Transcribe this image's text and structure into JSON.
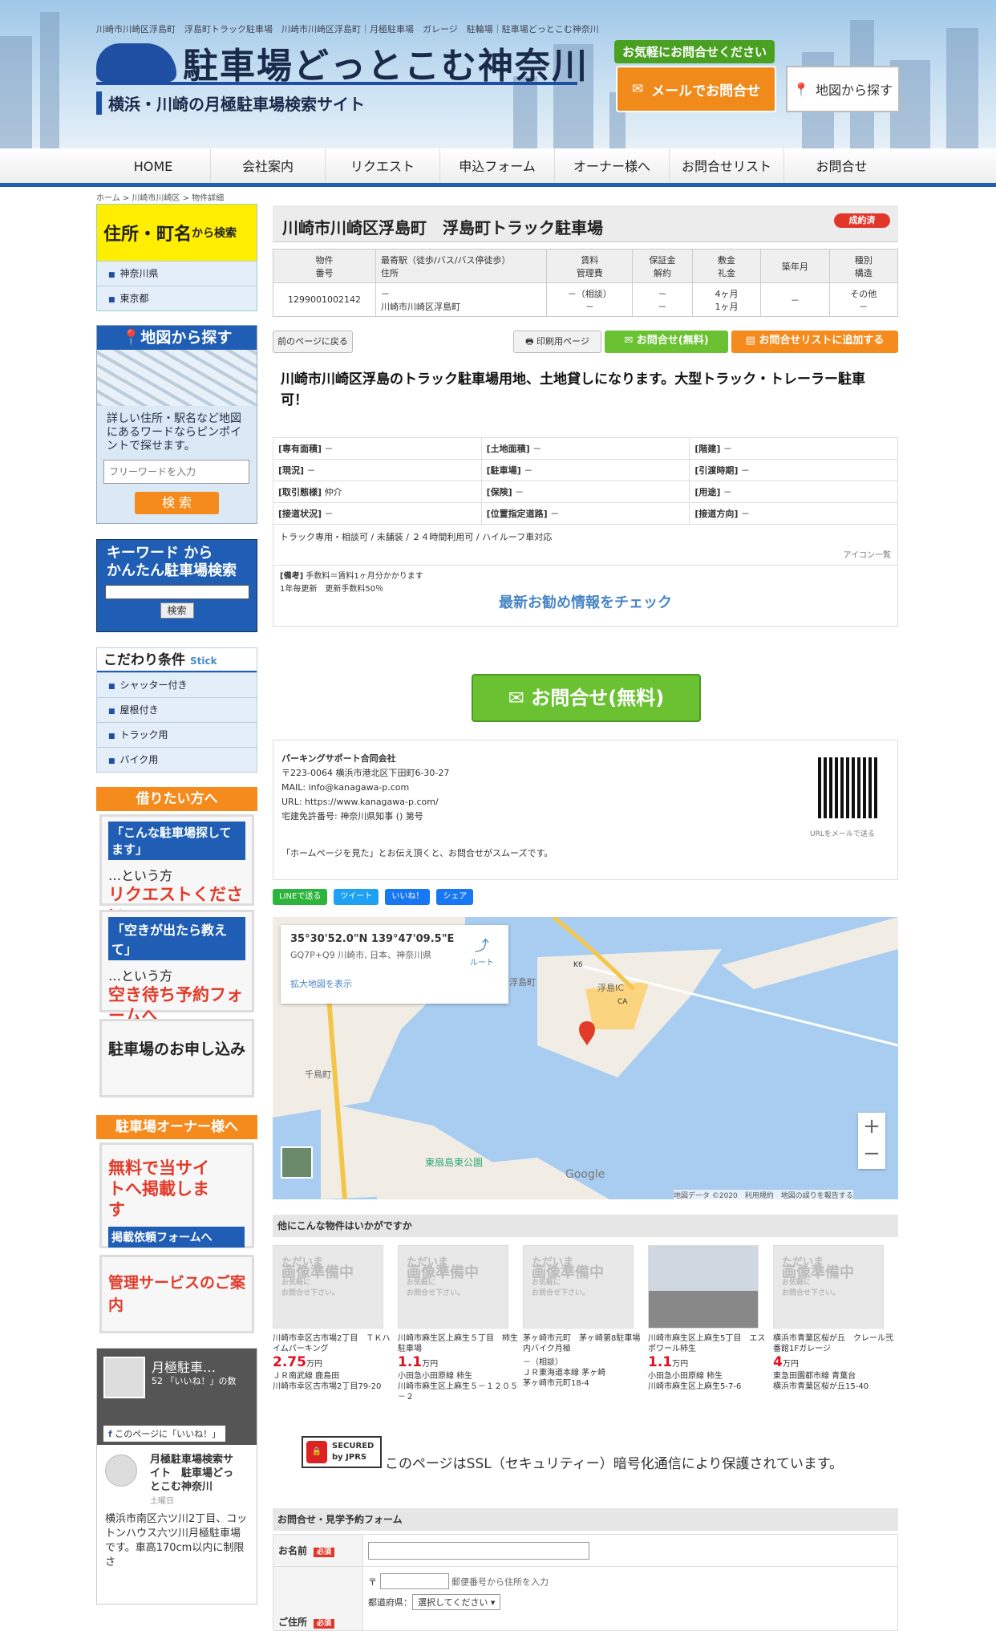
{
  "header": {
    "top_links": "川崎市川崎区浮島町　浮島町トラック駐車場　川崎市川崎区浮島町｜月極駐車場　ガレージ　駐輪場｜駐車場どっとこむ神奈川",
    "logo_title": "駐車場どっとこむ神奈川",
    "logo_sub": "横浜・川崎の月極駐車場検索サイト",
    "contact_label": "お気軽にお問合せください",
    "mail_button": "メールでお問合せ",
    "map_button": "地図から探す"
  },
  "nav": [
    "HOME",
    "会社案内",
    "リクエスト",
    "申込フォーム",
    "オーナー様へ",
    "お問合せリスト",
    "お問合せ"
  ],
  "breadcrumb": "ホーム > 川崎市川崎区 > 物件詳細",
  "sidebar": {
    "addr_title": "住所・町名",
    "addr_title_small": "から検索",
    "addr_items": [
      "神奈川県",
      "東京都"
    ],
    "map_title": "地図から探す",
    "map_text": "詳しい住所・駅名など地図にあるワードならピンポイントで探せます。",
    "map_placeholder": "フリーワードを入力",
    "map_button": "検 索",
    "kw_title": "キーワード から\nかんたん駐車場検索",
    "kw_button": "検索",
    "cond_title": "こだわり条件",
    "cond_stick": "Stick",
    "cond_items": [
      "シャッター付き",
      "屋根付き",
      "トラック用",
      "バイク用"
    ],
    "renter_head": "借りたい方へ",
    "banner1_top": "「こんな駐車場探してます」",
    "banner1_mid": "…という方",
    "banner1_big": "リクエストください",
    "banner2_top": "「空きが出たら教えて」",
    "banner2_mid": "…という方",
    "banner2_big": "空き待ち予約フォームへ",
    "banner3": "駐車場のお申し込み",
    "owner_head": "駐車場オーナー様へ",
    "banner4_big": "無料で当サイトへ掲載します",
    "banner4_sub": "掲載依頼フォームへ",
    "banner5": "管理サービスのご案内",
    "fb_title": "月極駐車…",
    "fb_likes": "52 「いいね！」の数",
    "fb_like_page": "このページに「いいね！」",
    "fb_page_name": "月極駐車場検索サイト　駐車場どっとこむ神奈川",
    "fb_day": "土曜日",
    "fb_post": "横浜市南区六ツ川2丁目、コットンハウス六ツ川月極駐車場です。車高170cm以内に制限さ"
  },
  "main": {
    "title": "川崎市川崎区浮島町　浮島町トラック駐車場",
    "badge": "成約済",
    "spec_headers": [
      [
        "物件",
        "番号"
      ],
      [
        "最寄駅（徒歩/バス/バス停徒歩）",
        "住所"
      ],
      [
        "賃料",
        "管理費"
      ],
      [
        "保証金",
        "解約"
      ],
      [
        "敷金",
        "礼金"
      ],
      [
        "築年月",
        ""
      ],
      [
        "種別",
        "構造"
      ]
    ],
    "spec_values": [
      [
        "1299001002142",
        ""
      ],
      [
        "－",
        "川崎市川崎区浮島町"
      ],
      [
        "－（相談）",
        "－"
      ],
      [
        "－",
        "－"
      ],
      [
        "4ヶ月",
        "1ヶ月"
      ],
      [
        "－",
        ""
      ],
      [
        "その他",
        "－"
      ]
    ],
    "back_button": "前のページに戻る",
    "print_button": "印刷用ページ",
    "inquiry_button": "お問合せ(無料)",
    "addlist_button": "お問合せリストに追加する",
    "description": "川崎市川崎区浮島のトラック駐車場用地、土地貸しになります。大型トラック・トレーラー駐車可！",
    "details": [
      [
        [
          "[専有面積]",
          "－"
        ],
        [
          "[土地面積]",
          "－"
        ],
        [
          "[階建]",
          "－"
        ]
      ],
      [
        [
          "[現況]",
          "－"
        ],
        [
          "[駐車場]",
          "－"
        ],
        [
          "[引渡時期]",
          "－"
        ]
      ],
      [
        [
          "[取引態様]",
          "仲介"
        ],
        [
          "[保険]",
          "－"
        ],
        [
          "[用途]",
          "－"
        ]
      ],
      [
        [
          "[接道状況]",
          "－"
        ],
        [
          "[位置指定道路]",
          "－"
        ],
        [
          "[接道方向]",
          "－"
        ]
      ]
    ],
    "features": "トラック専用・相談可 / 未舗装 / ２４時間利用可 / ハイルーフ車対応",
    "icon_list": "アイコン一覧",
    "remarks_label": "[備考]",
    "remarks": "手数料＝賃料1ヶ月分かかります",
    "remarks2": "1年毎更新　更新手数料50％",
    "recommend_link": "最新お勧め情報をチェック",
    "big_inquiry": "お問合せ(無料)",
    "company": {
      "name": "パーキングサポート合同会社",
      "addr": "〒223-0064 横浜市港北区下田町6-30-27",
      "mail": "MAIL: info@kanagawa-p.com",
      "url": "URL: https://www.kanagawa-p.com/",
      "license": "宅建免許番号: 神奈川県知事 () 第号",
      "qr_caption": "URLをメールで送る",
      "note": "「ホームページを見た」とお伝え頂くと、お問合せがスムーズです。"
    },
    "social": [
      "LINEで送る",
      "ツイート",
      "いいね！",
      "シェア"
    ],
    "map": {
      "coords": "35°30'52.0\"N 139°47'09.5\"E",
      "plus": "GQ7P+Q9 川崎市, 日本、神奈川県",
      "route": "ルート",
      "enlarge": "拡大地図を表示",
      "labels": [
        "浮島町",
        "浮島IC",
        "千鳥町",
        "東扇島東公園",
        "K6",
        "CA"
      ],
      "attrib": "地図データ ©2020　利用規約　地図の誤りを報告する",
      "google": "Google"
    },
    "other_title": "他にこんな物件はいかがですか",
    "placeholder_img": "ただいま",
    "placeholder_img2": "画像準備中",
    "placeholder_img3": "お気軽に\nお問合せ下さい。",
    "others": [
      {
        "name": "川崎市幸区古市場2丁目　ＴＫハイムパーキング",
        "price": "2.75",
        "unit": "万円",
        "station": "ＪＲ南武線 鹿島田",
        "addr": "川崎市幸区古市場2丁目79-20",
        "photo": false
      },
      {
        "name": "川崎市麻生区上麻生５丁目　柿生駐車場",
        "price": "1.1",
        "unit": "万円",
        "station": "小田急小田原線 柿生",
        "addr": "川崎市麻生区上麻生５－１２０５－２",
        "photo": false
      },
      {
        "name": "茅ヶ崎市元町　茅ヶ崎第8駐車場内バイク月極",
        "price": "",
        "unit": "",
        "station": "－（相談）\nＪＲ東海道本線 茅ヶ崎",
        "addr": "茅ヶ崎市元町18-4",
        "photo": false
      },
      {
        "name": "川崎市麻生区上麻生5丁目　エスポワール柿生",
        "price": "1.1",
        "unit": "万円",
        "station": "小田急小田原線 柿生",
        "addr": "川崎市麻生区上麻生5-7-6",
        "photo": true
      },
      {
        "name": "横浜市青葉区桜が丘　クレール弐番館1Fガレージ",
        "price": "4",
        "unit": "万円",
        "station": "東急田園都市線 青葉台",
        "addr": "横浜市青葉区桜が丘15-40",
        "photo": false
      }
    ],
    "ssl_badge": "SECURED by JPRS",
    "ssl_text": "このページはSSL（セキュリティー）暗号化通信により保護されています。",
    "form_title": "お問合せ・見学予約フォーム",
    "form": {
      "name_label": "お名前",
      "addr_label": "ご住所",
      "required": "必須",
      "zip_prefix": "〒",
      "zip_hint": "郵便番号から住所を入力",
      "pref_label": "都道府県：",
      "pref_select": "選択してください"
    }
  },
  "colors": {
    "brand": "#1f5eb4",
    "accent": "#f58a1d",
    "green": "#6ac232",
    "yellow": "#ffee00",
    "red": "#e2362a"
  }
}
